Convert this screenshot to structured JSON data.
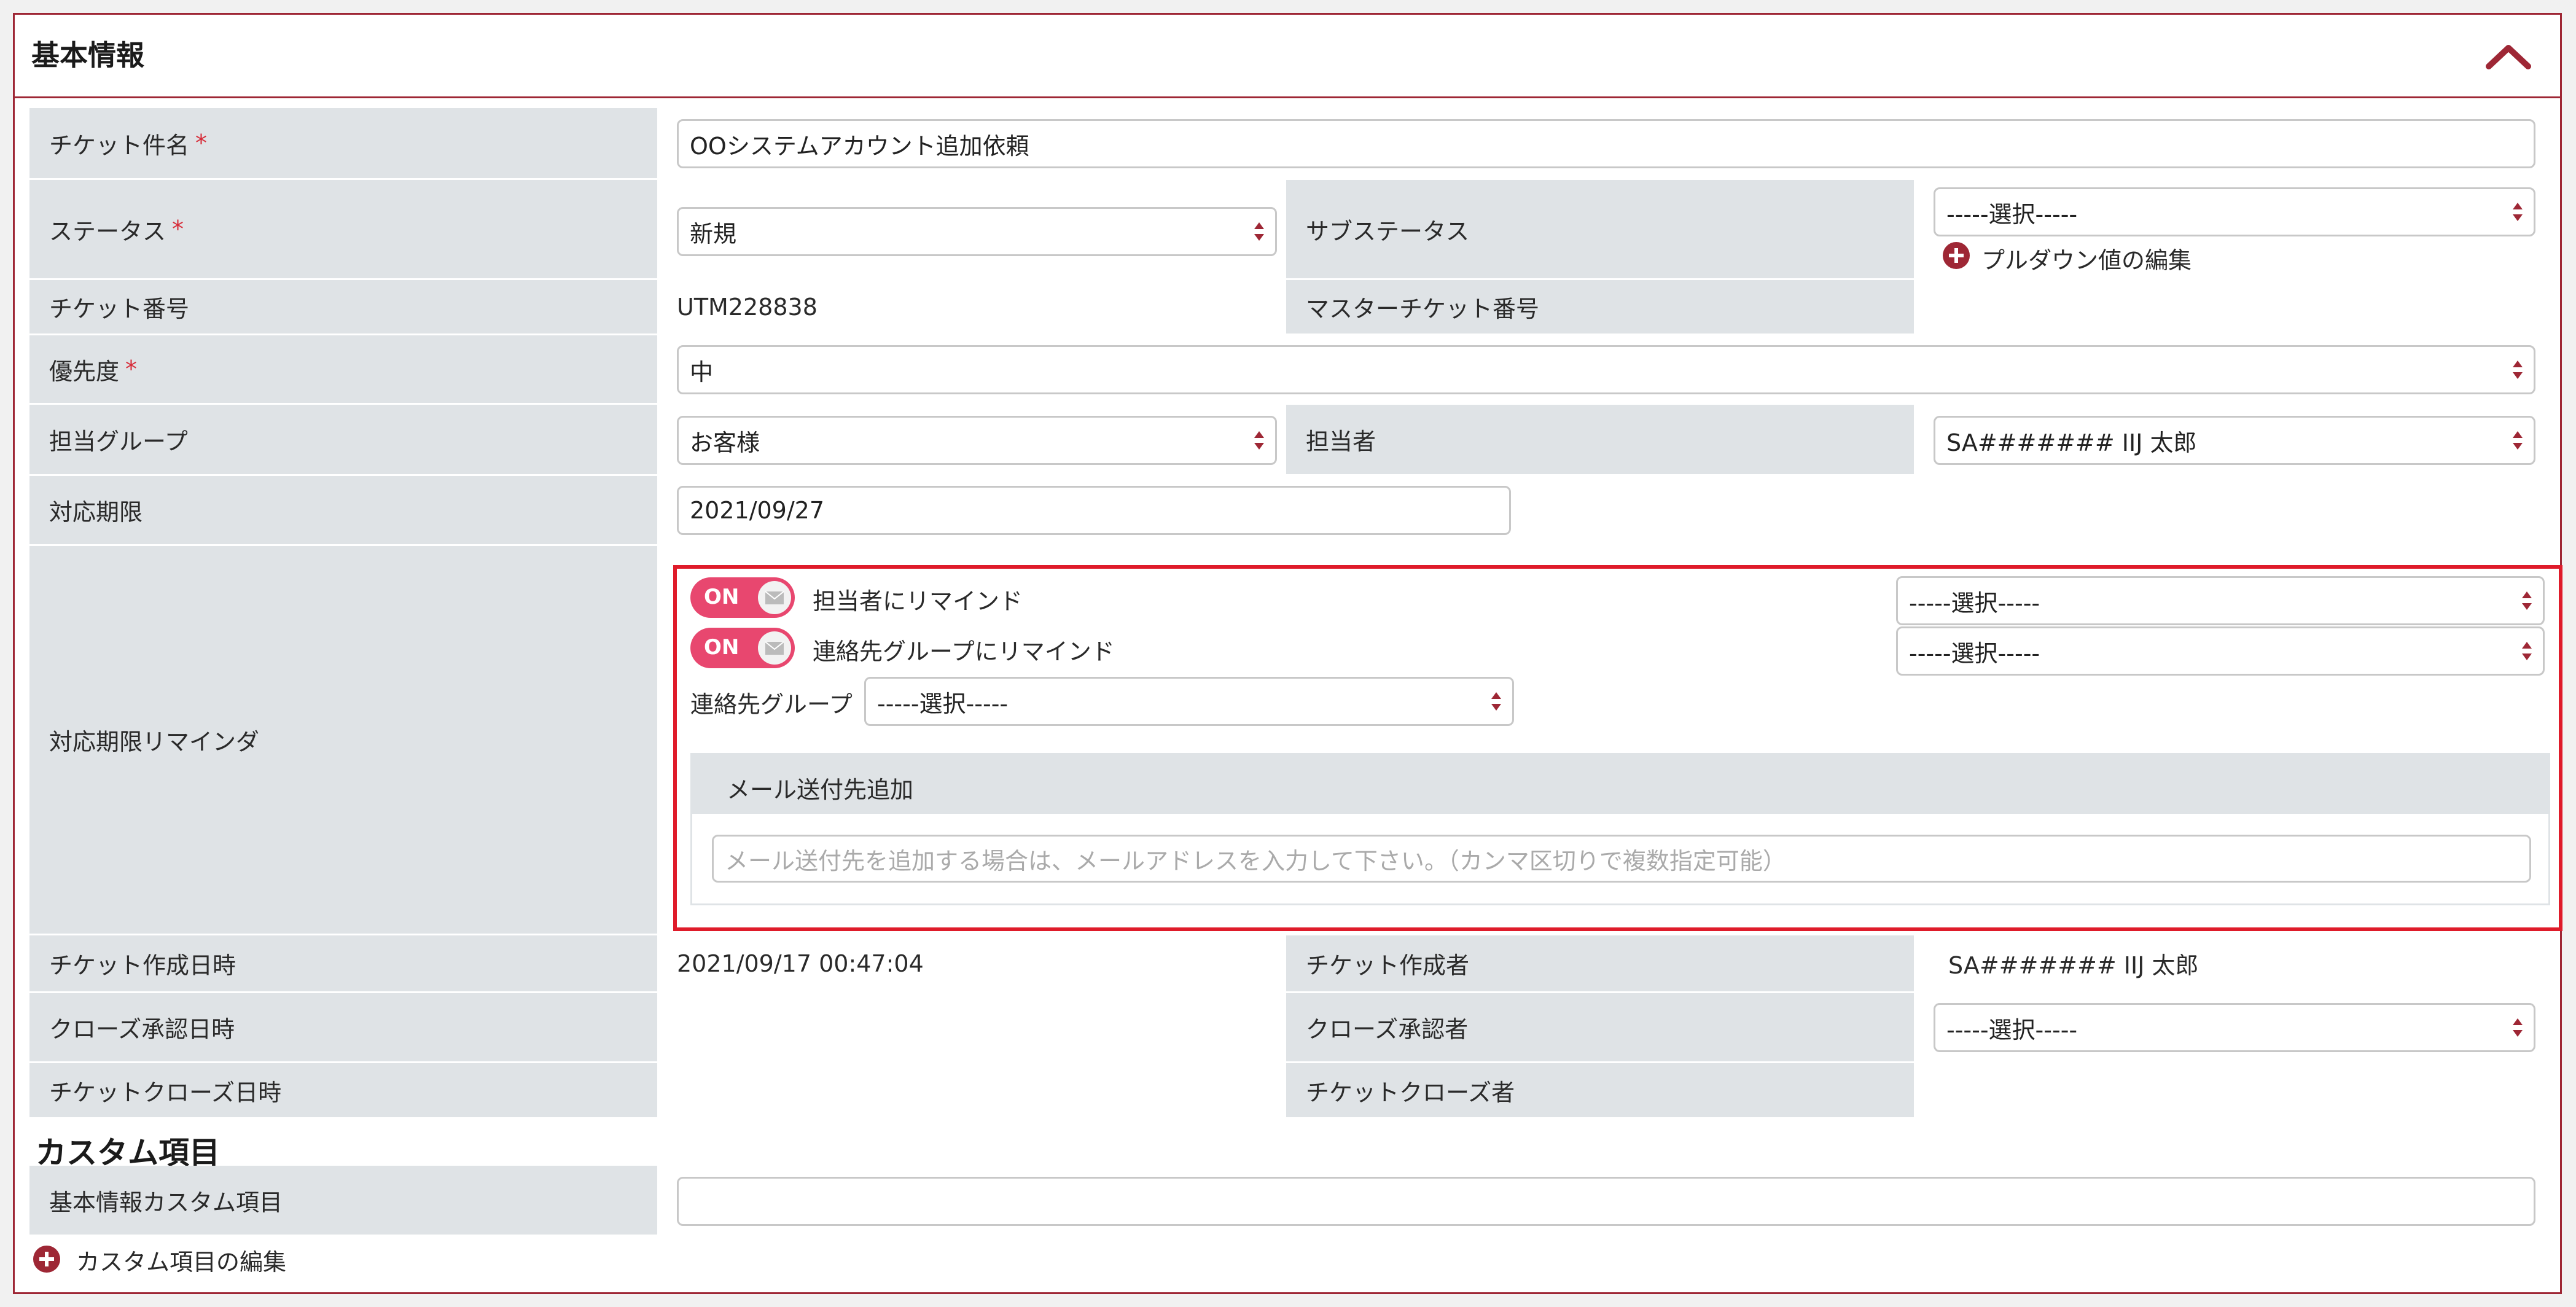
{
  "header": {
    "title": "基本情報",
    "collapse_icon": "chevron-up-icon"
  },
  "colors": {
    "accent": "#9e2735",
    "required": "#d72d3a",
    "toggle_on": "#e8476f",
    "highlight_border": "#df1b2a",
    "label_bg": "#dfe3e6"
  },
  "required_mark": "*",
  "fields": {
    "ticket_subject": {
      "label": "チケット件名",
      "value": "OOシステムアカウント追加依頼"
    },
    "status": {
      "label": "ステータス",
      "value": "新規"
    },
    "sub_status": {
      "label": "サブステータス",
      "value": "-----選択-----",
      "edit_link": "プルダウン値の編集"
    },
    "ticket_number": {
      "label": "チケット番号",
      "value": "UTM228838"
    },
    "master_ticket_number": {
      "label": "マスターチケット番号",
      "value": ""
    },
    "priority": {
      "label": "優先度",
      "value": "中"
    },
    "assigned_group": {
      "label": "担当グループ",
      "value": "お客様"
    },
    "assignee": {
      "label": "担当者",
      "value": "SA####### IIJ 太郎"
    },
    "due_date": {
      "label": "対応期限",
      "value": "2021/09/27"
    },
    "due_reminder": {
      "label": "対応期限リマインダ",
      "remind_assignee": {
        "toggle": "ON",
        "label": "担当者にリマインド",
        "select": "-----選択-----"
      },
      "remind_contact_group": {
        "toggle": "ON",
        "label": "連絡先グループにリマインド",
        "select": "-----選択-----"
      },
      "contact_group": {
        "label": "連絡先グループ",
        "select": "-----選択-----"
      },
      "mail_add": {
        "title": "メール送付先追加",
        "placeholder": "メール送付先を追加する場合は、メールアドレスを入力して下さい。（カンマ区切りで複数指定可能）"
      }
    },
    "created_at": {
      "label": "チケット作成日時",
      "value": "2021/09/17 00:47:04"
    },
    "created_by": {
      "label": "チケット作成者",
      "value": "SA####### IIJ 太郎"
    },
    "close_approved_at": {
      "label": "クローズ承認日時",
      "value": ""
    },
    "close_approver": {
      "label": "クローズ承認者",
      "value": "-----選択-----"
    },
    "closed_at": {
      "label": "チケットクローズ日時",
      "value": ""
    },
    "closed_by": {
      "label": "チケットクローズ者",
      "value": ""
    }
  },
  "custom": {
    "title": "カスタム項目",
    "basic_custom_field": {
      "label": "基本情報カスタム項目",
      "value": ""
    },
    "edit_link": "カスタム項目の編集"
  }
}
